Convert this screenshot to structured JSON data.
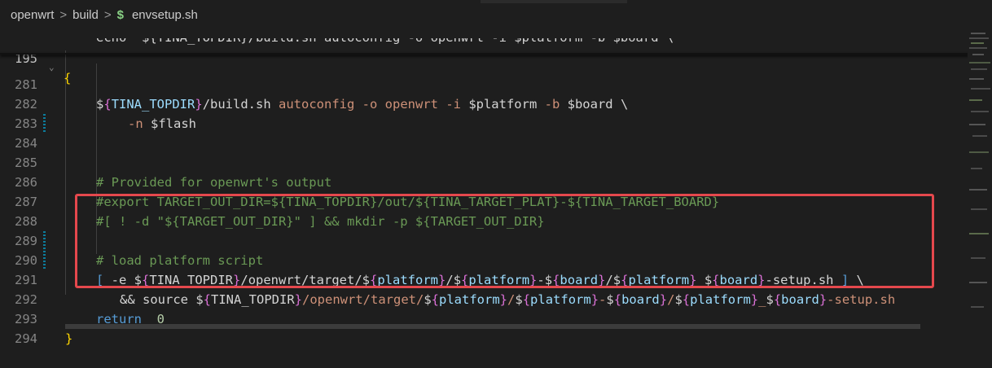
{
  "breadcrumb": {
    "folder1": "openwrt",
    "folder2": "build",
    "file_icon": "$",
    "file": "envsetup.sh",
    "separator": ">"
  },
  "sticky": {
    "line_number": "195",
    "text": "{"
  },
  "ghost_line": "echo \"${TINA_TOPDIR}/build.sh autoconfig -o openwrt -i $platform -b $board \\",
  "lines": [
    {
      "n": "281"
    },
    {
      "n": "282"
    },
    {
      "n": "283"
    },
    {
      "n": "284"
    },
    {
      "n": "285"
    },
    {
      "n": "286"
    },
    {
      "n": "287"
    },
    {
      "n": "288"
    },
    {
      "n": "289"
    },
    {
      "n": "290"
    },
    {
      "n": "291"
    },
    {
      "n": "292"
    },
    {
      "n": "293"
    },
    {
      "n": "294"
    }
  ],
  "code": {
    "l281": {
      "a": "$",
      "b": "{",
      "c": "TINA_TOPDIR",
      "d": "}",
      "e": "/build.sh ",
      "f": "autoconfig -o openwrt -i ",
      "g": "$platform",
      "h": " -b ",
      "i": "$board",
      "j": " \\"
    },
    "l282": {
      "a": "-n ",
      "b": "$flash"
    },
    "l285": "# Provided for openwrt's output",
    "l286": "#export TARGET_OUT_DIR=${TINA_TOPDIR}/out/${TINA_TARGET_PLAT}-${TINA_TARGET_BOARD}",
    "l287": "#[ ! -d \"${TARGET_OUT_DIR}\" ] && mkdir -p ${TARGET_OUT_DIR}",
    "l289": "# load platform script",
    "l290": {
      "p1": "[",
      "p2": " -e ",
      "p3": "$",
      "p4": "{",
      "p5": "TINA_TOPDIR",
      "p6": "}",
      "p7": "/openwrt/target/",
      "p8": "$",
      "p9": "{",
      "p10": "platform",
      "p11": "}",
      "p12": "/",
      "p13": "$",
      "p14": "{",
      "p15": "platform",
      "p16": "}",
      "p17": "-",
      "p18": "$",
      "p19": "{",
      "p20": "board",
      "p21": "}",
      "p22": "/",
      "p23": "$",
      "p24": "{",
      "p25": "platform",
      "p26": "}",
      "p27": "_",
      "p28": "$",
      "p29": "{",
      "p30": "board",
      "p31": "}",
      "p32": "-setup.sh ",
      "p33": "]",
      "p34": " \\"
    },
    "l291": {
      "p1": "&& ",
      "p2": "source ",
      "p3": "$",
      "p4": "{",
      "p5": "TINA_TOPDIR",
      "p6": "}",
      "p7": "/openwrt/target/",
      "p8": "$",
      "p9": "{",
      "p10": "platform",
      "p11": "}",
      "p12": "/",
      "p13": "$",
      "p14": "{",
      "p15": "platform",
      "p16": "}",
      "p17": "-",
      "p18": "$",
      "p19": "{",
      "p20": "board",
      "p21": "}",
      "p22": "/",
      "p23": "$",
      "p24": "{",
      "p25": "platform",
      "p26": "}",
      "p27": "_",
      "p28": "$",
      "p29": "{",
      "p30": "board",
      "p31": "}",
      "p32": "-setup.sh"
    },
    "l292": {
      "kw": "return",
      "num": "0"
    },
    "l293": "}"
  },
  "colors": {
    "background": "#1e1e1e",
    "highlight_border": "#e5484d",
    "comment": "#6a9955",
    "string": "#ce9178",
    "variable": "#9cdcfe",
    "keyword": "#569cd6",
    "bracket": "#ffd700"
  }
}
